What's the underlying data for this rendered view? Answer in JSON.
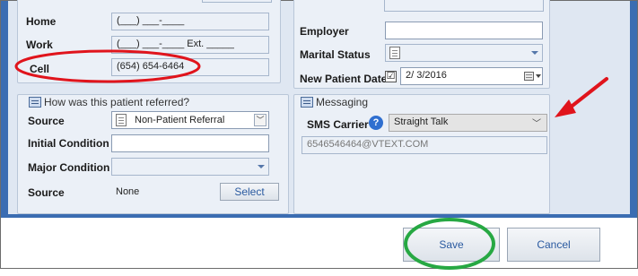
{
  "contact": {
    "home_label": "Home",
    "home_value": "(___) ___-____",
    "work_label": "Work",
    "work_value": "(___) ___-____ Ext. _____",
    "cell_label": "Cell",
    "cell_value": "(654) 654-6464"
  },
  "employment": {
    "employer_label": "Employer",
    "employer_value": "",
    "marital_label": "Marital Status",
    "marital_value": "",
    "new_patient_label": "New Patient Date",
    "new_patient_checked": "☑",
    "new_patient_value": "2/ 3/2016"
  },
  "referral": {
    "title": "How was this patient referred?",
    "source_label": "Source",
    "source_value": "Non-Patient Referral",
    "initial_label": "Initial Condition",
    "initial_value": "",
    "major_label": "Major Condition",
    "major_value": "",
    "source2_label": "Source",
    "source2_value": "None",
    "select_label": "Select"
  },
  "messaging": {
    "title": "Messaging",
    "sms_label": "SMS Carrier",
    "help_glyph": "?",
    "sms_value": "Straight Talk",
    "email_value": "6546546464@VTEXT.COM"
  },
  "footer": {
    "save_label": "Save",
    "cancel_label": "Cancel"
  },
  "annotations": {
    "red": "#e0141c",
    "green": "#27a843"
  },
  "icons": [
    "group-icon",
    "document-icon",
    "help-icon",
    "calendar-icon",
    "dropdown-arrow-icon",
    "chevron-down-icon",
    "red-arrow"
  ]
}
